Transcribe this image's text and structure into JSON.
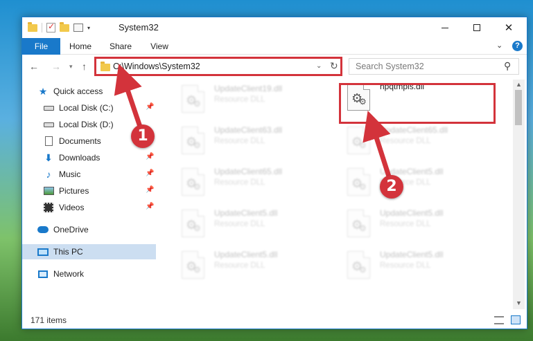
{
  "window": {
    "title": "System32"
  },
  "ribbon": {
    "tabs": [
      "File",
      "Home",
      "Share",
      "View"
    ],
    "help": "?"
  },
  "nav": {
    "address": "C:\\Windows\\System32",
    "search_placeholder": "Search System32"
  },
  "sidebar": {
    "items": [
      {
        "label": "Quick access",
        "icon": "star-icon"
      },
      {
        "label": "Local Disk (C:)",
        "icon": "disk-icon"
      },
      {
        "label": "Local Disk (D:)",
        "icon": "disk-icon"
      },
      {
        "label": "Documents",
        "icon": "document-icon"
      },
      {
        "label": "Downloads",
        "icon": "download-icon"
      },
      {
        "label": "Music",
        "icon": "music-icon"
      },
      {
        "label": "Pictures",
        "icon": "pictures-icon"
      },
      {
        "label": "Videos",
        "icon": "videos-icon"
      },
      {
        "label": "OneDrive",
        "icon": "cloud-icon"
      },
      {
        "label": "This PC",
        "icon": "computer-icon"
      },
      {
        "label": "Network",
        "icon": "network-icon"
      }
    ]
  },
  "files": [
    {
      "name": "UpdateClient19.dll",
      "type": "Resource DLL"
    },
    {
      "name": "hpqtmpls.dll",
      "type": ""
    },
    {
      "name": "UpdateClient63.dll",
      "type": "Resource DLL"
    },
    {
      "name": "UpdateClient65.dll",
      "type": "Resource DLL"
    },
    {
      "name": "UpdateClient65.dll",
      "type": "Resource DLL"
    },
    {
      "name": "UpdateClient5.dll",
      "type": "Resource DLL"
    },
    {
      "name": "UpdateClient5.dll",
      "type": "Resource DLL"
    },
    {
      "name": "UpdateClient5.dll",
      "type": "Resource DLL"
    },
    {
      "name": "UpdateClient5.dll",
      "type": "Resource DLL"
    },
    {
      "name": "UpdateClient5.dll",
      "type": "Resource DLL"
    }
  ],
  "status": {
    "item_count": "171 items"
  },
  "callouts": [
    "1",
    "2"
  ],
  "colors": {
    "accent": "#1979ca",
    "highlight": "#d3333b"
  }
}
